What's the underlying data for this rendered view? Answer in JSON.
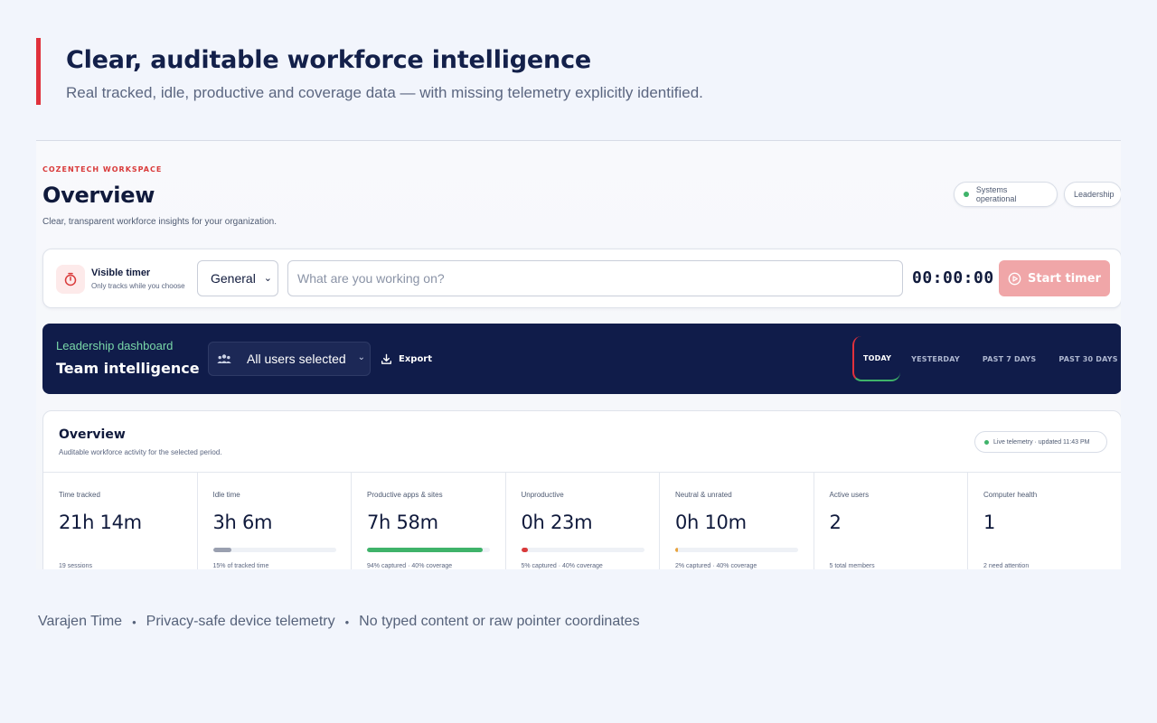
{
  "hero": {
    "title": "Clear, auditable workforce intelligence",
    "subtitle": "Real tracked, idle, productive and coverage data — with missing telemetry explicitly identified.",
    "accent": "#e0313c"
  },
  "workspace": {
    "label": "COZENTECH WORKSPACE",
    "title": "Overview",
    "subtitle": "Clear, transparent workforce insights for your organization.",
    "status_pill": "Systems operational",
    "role_pill": "Leadership"
  },
  "timer": {
    "title": "Visible timer",
    "note": "Only tracks while you choose",
    "category": "General",
    "task_placeholder": "What are you working on?",
    "task_value": "",
    "elapsed": "00:00:00",
    "start_label": "Start timer"
  },
  "dashboard": {
    "kicker": "Leadership dashboard",
    "title": "Team intelligence",
    "users_filter": "All users selected",
    "export_label": "Export",
    "tabs": [
      {
        "label": "TODAY",
        "active": true
      },
      {
        "label": "YESTERDAY",
        "active": false
      },
      {
        "label": "PAST 7 DAYS",
        "active": false
      },
      {
        "label": "PAST 30 DAYS",
        "active": false
      }
    ]
  },
  "overview": {
    "title": "Overview",
    "subtitle": "Auditable workforce activity for the selected period.",
    "live_status": "Live telemetry · updated 11:43 PM",
    "stats": [
      {
        "label": "Time tracked",
        "value": "21h 14m",
        "note": "19 sessions",
        "bar": null
      },
      {
        "label": "Idle time",
        "value": "3h 6m",
        "note": "15% of tracked time",
        "bar": {
          "fraction": 0.15,
          "color": "#9aa0b0"
        }
      },
      {
        "label": "Productive apps & sites",
        "value": "7h 58m",
        "note": "94% captured · 40% coverage",
        "bar": {
          "fraction": 0.94,
          "color": "#3fb36a"
        }
      },
      {
        "label": "Unproductive",
        "value": "0h 23m",
        "note": "5% captured · 40% coverage",
        "bar": {
          "fraction": 0.05,
          "color": "#d93a3a"
        }
      },
      {
        "label": "Neutral & unrated",
        "value": "0h 10m",
        "note": "2% captured · 40% coverage",
        "bar": {
          "fraction": 0.02,
          "color": "#e8a23b"
        }
      },
      {
        "label": "Active users",
        "value": "2",
        "note": "5 total members",
        "bar": null
      },
      {
        "label": "Computer health",
        "value": "1",
        "note": "2 need attention",
        "bar": null
      }
    ]
  },
  "footer": {
    "items": [
      "Varajen Time",
      "Privacy-safe device telemetry",
      "No typed content or raw pointer coordinates"
    ],
    "separator": "•"
  }
}
